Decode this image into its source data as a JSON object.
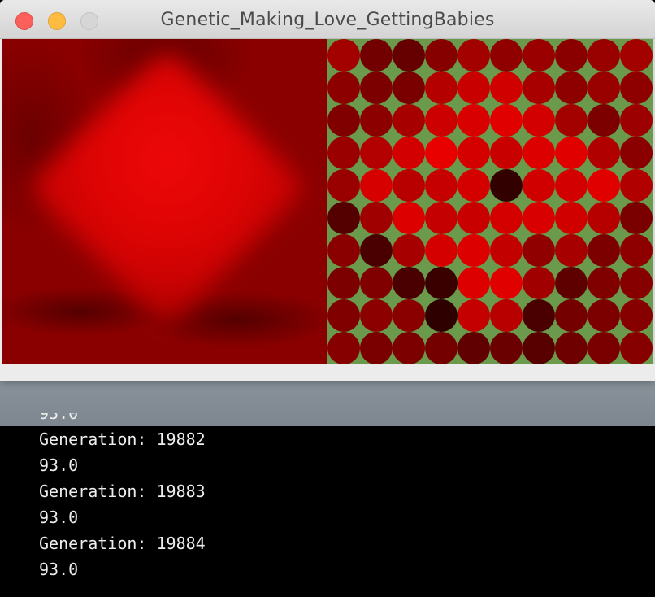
{
  "window": {
    "title": "Genetic_Making_Love_GettingBabies"
  },
  "grid": {
    "rows": 10,
    "cols": 10,
    "background": "#6b9a4c",
    "colors": [
      [
        "#a30000",
        "#730000",
        "#660000",
        "#870000",
        "#a30000",
        "#900000",
        "#9a0000",
        "#8a0000",
        "#990000",
        "#a30000"
      ],
      [
        "#8c0000",
        "#7d0000",
        "#7a0000",
        "#b50000",
        "#c80000",
        "#d00000",
        "#a80000",
        "#8e0000",
        "#990000",
        "#8e0000"
      ],
      [
        "#800000",
        "#8c0000",
        "#a60000",
        "#cc0000",
        "#d80000",
        "#e00000",
        "#d20000",
        "#a30000",
        "#7d0000",
        "#9c0000"
      ],
      [
        "#9a0000",
        "#b30000",
        "#d20000",
        "#e80000",
        "#d40000",
        "#c80000",
        "#dc0000",
        "#e00000",
        "#b00000",
        "#8a0000"
      ],
      [
        "#990000",
        "#d60000",
        "#b80000",
        "#c60000",
        "#d40000",
        "#330000",
        "#d00000",
        "#d20000",
        "#e00000",
        "#b00000"
      ],
      [
        "#540000",
        "#a00000",
        "#dc0000",
        "#c40000",
        "#c80000",
        "#d40000",
        "#d80000",
        "#d00000",
        "#b60000",
        "#7a0000"
      ],
      [
        "#8a0000",
        "#4a0000",
        "#a60000",
        "#d40000",
        "#dc0000",
        "#c20000",
        "#900000",
        "#a60000",
        "#7d0000",
        "#8e0000"
      ],
      [
        "#7d0000",
        "#800000",
        "#4a0000",
        "#3a0000",
        "#dc0000",
        "#e00000",
        "#a00000",
        "#5e0000",
        "#800000",
        "#870000"
      ],
      [
        "#800000",
        "#8c0000",
        "#8a0000",
        "#2e0000",
        "#c40000",
        "#b80000",
        "#4a0000",
        "#740000",
        "#7d0000",
        "#870000"
      ],
      [
        "#870000",
        "#7a0000",
        "#7d0000",
        "#740000",
        "#600000",
        "#6b0000",
        "#580000",
        "#6e0000",
        "#7a0000",
        "#870000"
      ]
    ]
  },
  "console": {
    "cut_line": "93.0",
    "lines": [
      "Generation: 19882",
      "93.0",
      "Generation: 19883",
      "93.0",
      "Generation: 19884",
      "93.0"
    ]
  }
}
